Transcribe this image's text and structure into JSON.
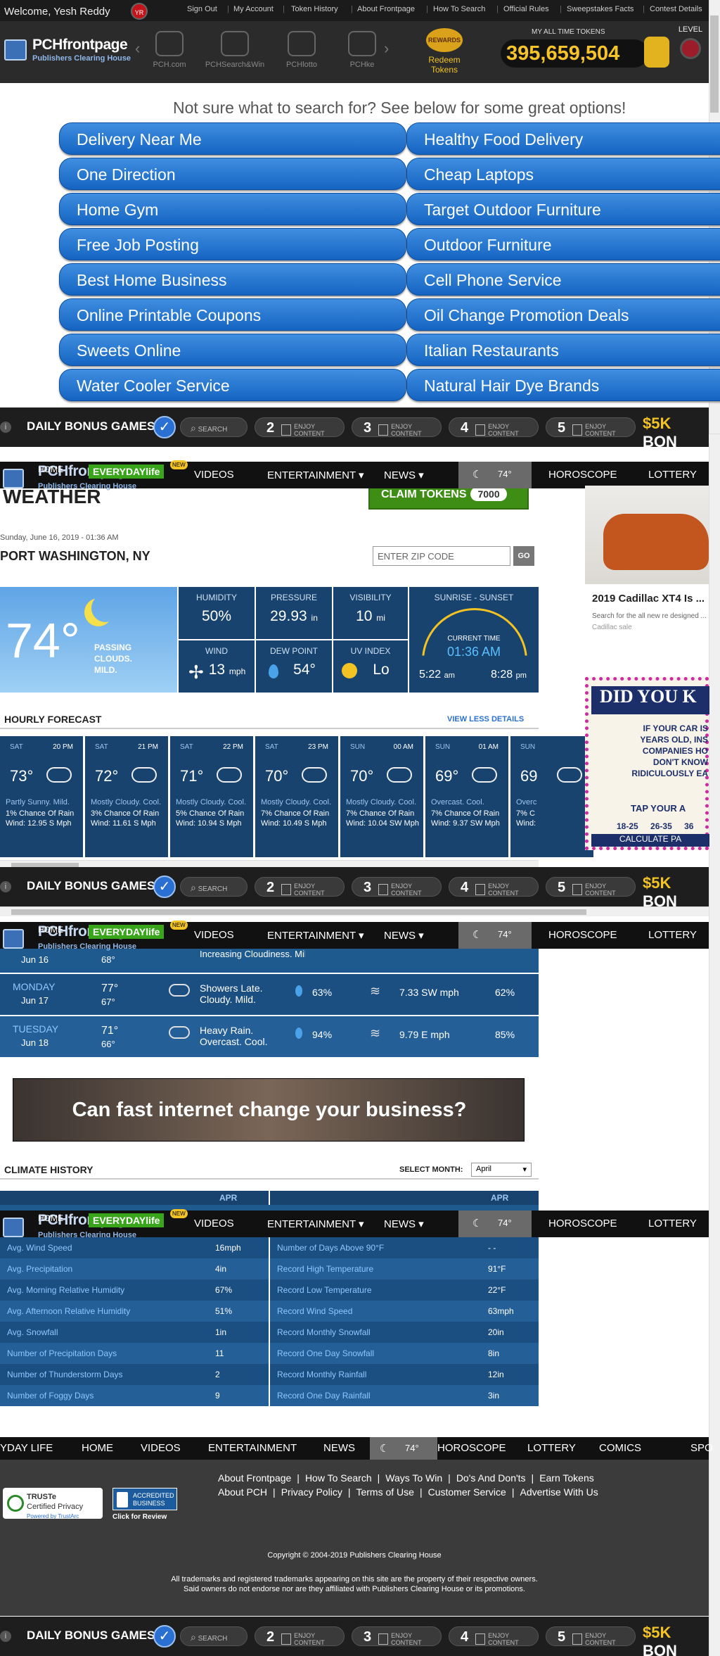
{
  "topbar": {
    "welcome": "Welcome, Yesh Reddy",
    "avatar_initials": "YR",
    "links": [
      "Sign Out",
      "My Account",
      "Token History",
      "About Frontpage",
      "How To Search",
      "Official Rules",
      "Sweepstakes Facts",
      "Contest Details"
    ]
  },
  "brand": {
    "logo_main": "PCHfrontpage",
    "logo_sub": "Publishers Clearing House",
    "nav_items": [
      "PCH.com",
      "PCHSearch&Win",
      "PCHlotto",
      "PCHke"
    ],
    "rewards_badge": "REWARDS",
    "rewards_label": "Redeem Tokens",
    "tokens_label": "MY ALL TIME TOKENS",
    "tokens_value": "395,659,504",
    "level_label": "LEVEL"
  },
  "suggestions": {
    "heading": "Not sure what to search for? See below for some great options!",
    "left": [
      "Delivery Near Me",
      "One Direction",
      "Home Gym",
      "Free Job Posting",
      "Best Home Business",
      "Online Printable Coupons",
      "Sweets Online",
      "Water Cooler Service"
    ],
    "right": [
      "Healthy Food Delivery",
      "Cheap Laptops",
      "Target Outdoor Furniture",
      "Outdoor Furniture",
      "Cell Phone Service",
      "Oil Change Promotion Deals",
      "Italian Restaurants",
      "Natural Hair Dye Brands"
    ]
  },
  "bonus": {
    "title": "DAILY BONUS GAMES",
    "search_label": "SEARCH",
    "steps": [
      {
        "n": "2",
        "label": "ENJOY CONTENT"
      },
      {
        "n": "3",
        "label": "ENJOY CONTENT"
      },
      {
        "n": "4",
        "label": "ENJOY CONTENT"
      },
      {
        "n": "5",
        "label": "ENJOY CONTENT"
      }
    ],
    "prize_amount": "$5K",
    "prize_word": "BON"
  },
  "sitenav": {
    "items": [
      "HOME",
      "VIDEOS",
      "ENTERTAINMENT ▾",
      "NEWS ▾",
      "HOROSCOPE",
      "LOTTERY"
    ],
    "everyday": "EVERYDAYlife",
    "new_badge": "NEW",
    "weather_temp": "74°"
  },
  "weather": {
    "title": "WEATHER",
    "claim_label": "CLAIM TOKENS",
    "claim_value": "7000",
    "date": "Sunday, June 16, 2019 - 01:36 AM",
    "city": "PORT WASHINGTON, NY",
    "zip_placeholder": "ENTER ZIP CODE",
    "go": "GO",
    "temp": "74°",
    "condition": [
      "PASSING",
      "CLOUDS.",
      "MILD."
    ],
    "humidity": {
      "label": "HUMIDITY",
      "value": "50%"
    },
    "pressure": {
      "label": "PRESSURE",
      "value": "29.93",
      "unit": "in"
    },
    "visibility": {
      "label": "VISIBILITY",
      "value": "10",
      "unit": "mi"
    },
    "wind": {
      "label": "WIND",
      "value": "13",
      "unit": "mph"
    },
    "dewpoint": {
      "label": "DEW POINT",
      "value": "54°"
    },
    "uv": {
      "label": "UV INDEX",
      "value": "Lo"
    },
    "sun": {
      "label": "SUNRISE - SUNSET",
      "current_label": "CURRENT TIME",
      "current": "01:36 AM",
      "rise": "5:22",
      "rise_ampm": "am",
      "set": "8:28",
      "set_ampm": "pm"
    }
  },
  "hourly": {
    "title": "HOURLY FORECAST",
    "less": "VIEW LESS DETAILS",
    "cards": [
      {
        "day": "SAT",
        "time": "20 PM",
        "temp": "73°",
        "desc": "Partly Sunny. Mild.",
        "rain": "1% Chance Of Rain",
        "wind": "Wind: 12.95 S Mph"
      },
      {
        "day": "SAT",
        "time": "21 PM",
        "temp": "72°",
        "desc": "Mostly Cloudy. Cool.",
        "rain": "3% Chance Of Rain",
        "wind": "Wind: 11.61 S Mph"
      },
      {
        "day": "SAT",
        "time": "22 PM",
        "temp": "71°",
        "desc": "Mostly Cloudy. Cool.",
        "rain": "5% Chance Of Rain",
        "wind": "Wind: 10.94 S Mph"
      },
      {
        "day": "SAT",
        "time": "23 PM",
        "temp": "70°",
        "desc": "Mostly Cloudy. Cool.",
        "rain": "7% Chance Of Rain",
        "wind": "Wind: 10.49 S Mph"
      },
      {
        "day": "SUN",
        "time": "00 AM",
        "temp": "70°",
        "desc": "Mostly Cloudy. Cool.",
        "rain": "7% Chance Of Rain",
        "wind": "Wind: 10.04 SW Mph"
      },
      {
        "day": "SUN",
        "time": "01 AM",
        "temp": "69°",
        "desc": "Overcast. Cool.",
        "rain": "7% Chance Of Rain",
        "wind": "Wind: 9.37 SW Mph"
      },
      {
        "day": "SUN",
        "time": "",
        "temp": "69",
        "desc": "Overc",
        "rain": "7% C",
        "wind": "Wind:"
      }
    ]
  },
  "ads": {
    "car_title": "2019 Cadillac XT4 Is ...",
    "car_desc": "Search for the all new re designed ...",
    "car_source": "Cadillac sale",
    "didyou_title": "DID YOU K",
    "didyou_lines": [
      "IF YOUR CAR IS",
      "YEARS OLD, INS",
      "COMPANIES HO",
      "DON'T KNOW",
      "RIDICULOUSLY EA"
    ],
    "didyou_cta": "TAP YOUR A",
    "didyou_ages": [
      "18-25",
      "26-35",
      "36"
    ],
    "didyou_calc": "CALCULATE PA"
  },
  "daily": {
    "partial": {
      "date": "Jun 16",
      "low": "68°",
      "cond": "Increasing Cloudiness. Mild."
    },
    "rows": [
      {
        "day": "MONDAY",
        "date": "Jun 17",
        "hi": "77°",
        "lo": "67°",
        "cond1": "Showers Late.",
        "cond2": "Cloudy. Mild.",
        "precip": "63%",
        "wind": "7.33 SW mph",
        "hum": "62%"
      },
      {
        "day": "TUESDAY",
        "date": "Jun 18",
        "hi": "71°",
        "lo": "66°",
        "cond1": "Heavy Rain.",
        "cond2": "Overcast. Cool.",
        "precip": "94%",
        "wind": "9.79 E mph",
        "hum": "85%"
      }
    ]
  },
  "banner": {
    "text": "Can fast internet change your business?"
  },
  "climate": {
    "title": "CLIMATE HISTORY",
    "select_label": "SELECT MONTH:",
    "month": "April",
    "col_head": "APR",
    "left": [
      {
        "k": "Avg. Wind Speed",
        "v": "16mph"
      },
      {
        "k": "Avg. Precipitation",
        "v": "4in"
      },
      {
        "k": "Avg. Morning Relative Humidity",
        "v": "67%"
      },
      {
        "k": "Avg. Afternoon Relative Humidity",
        "v": "51%"
      },
      {
        "k": "Avg. Snowfall",
        "v": "1in"
      },
      {
        "k": "Number of Precipitation Days",
        "v": "11"
      },
      {
        "k": "Number of Thunderstorm Days",
        "v": "2"
      },
      {
        "k": "Number of Foggy Days",
        "v": "9"
      }
    ],
    "right": [
      {
        "k": "Number of Days Above 90°F",
        "v": "- -"
      },
      {
        "k": "Record High Temperature",
        "v": "91°F"
      },
      {
        "k": "Record Low Temperature",
        "v": "22°F"
      },
      {
        "k": "Record Wind Speed",
        "v": "63mph"
      },
      {
        "k": "Record Monthly Snowfall",
        "v": "20in"
      },
      {
        "k": "Record One Day Snowfall",
        "v": "8in"
      },
      {
        "k": "Record Monthly Rainfall",
        "v": "12in"
      },
      {
        "k": "Record One Day Rainfall",
        "v": "3in"
      }
    ]
  },
  "footernav": {
    "items": [
      "YDAY LIFE",
      "HOME",
      "VIDEOS",
      "ENTERTAINMENT",
      "NEWS",
      "74°",
      "HOROSCOPE",
      "LOTTERY",
      "COMICS",
      "SPO"
    ]
  },
  "footer": {
    "row1": [
      "About Frontpage",
      "How To Search",
      "Ways To Win",
      "Do's And Don'ts",
      "Earn Tokens"
    ],
    "row2": [
      "About PCH",
      "Privacy Policy",
      "Terms of Use",
      "Customer Service",
      "Advertise With Us"
    ],
    "truste1": "TRUSTe",
    "truste2": "Certified Privacy",
    "truste3": "Powered by TrustArc",
    "bbb1": "ACCREDITED",
    "bbb2": "BUSINESS",
    "bbb3": "Click for Review",
    "copyright": "Copyright © 2004-2019 Publishers Clearing House",
    "legal1": "All trademarks and registered trademarks appearing on this site are the property of their respective owners.",
    "legal2": "Said owners do not endorse nor are they affiliated with Publishers Clearing House or its promotions."
  }
}
